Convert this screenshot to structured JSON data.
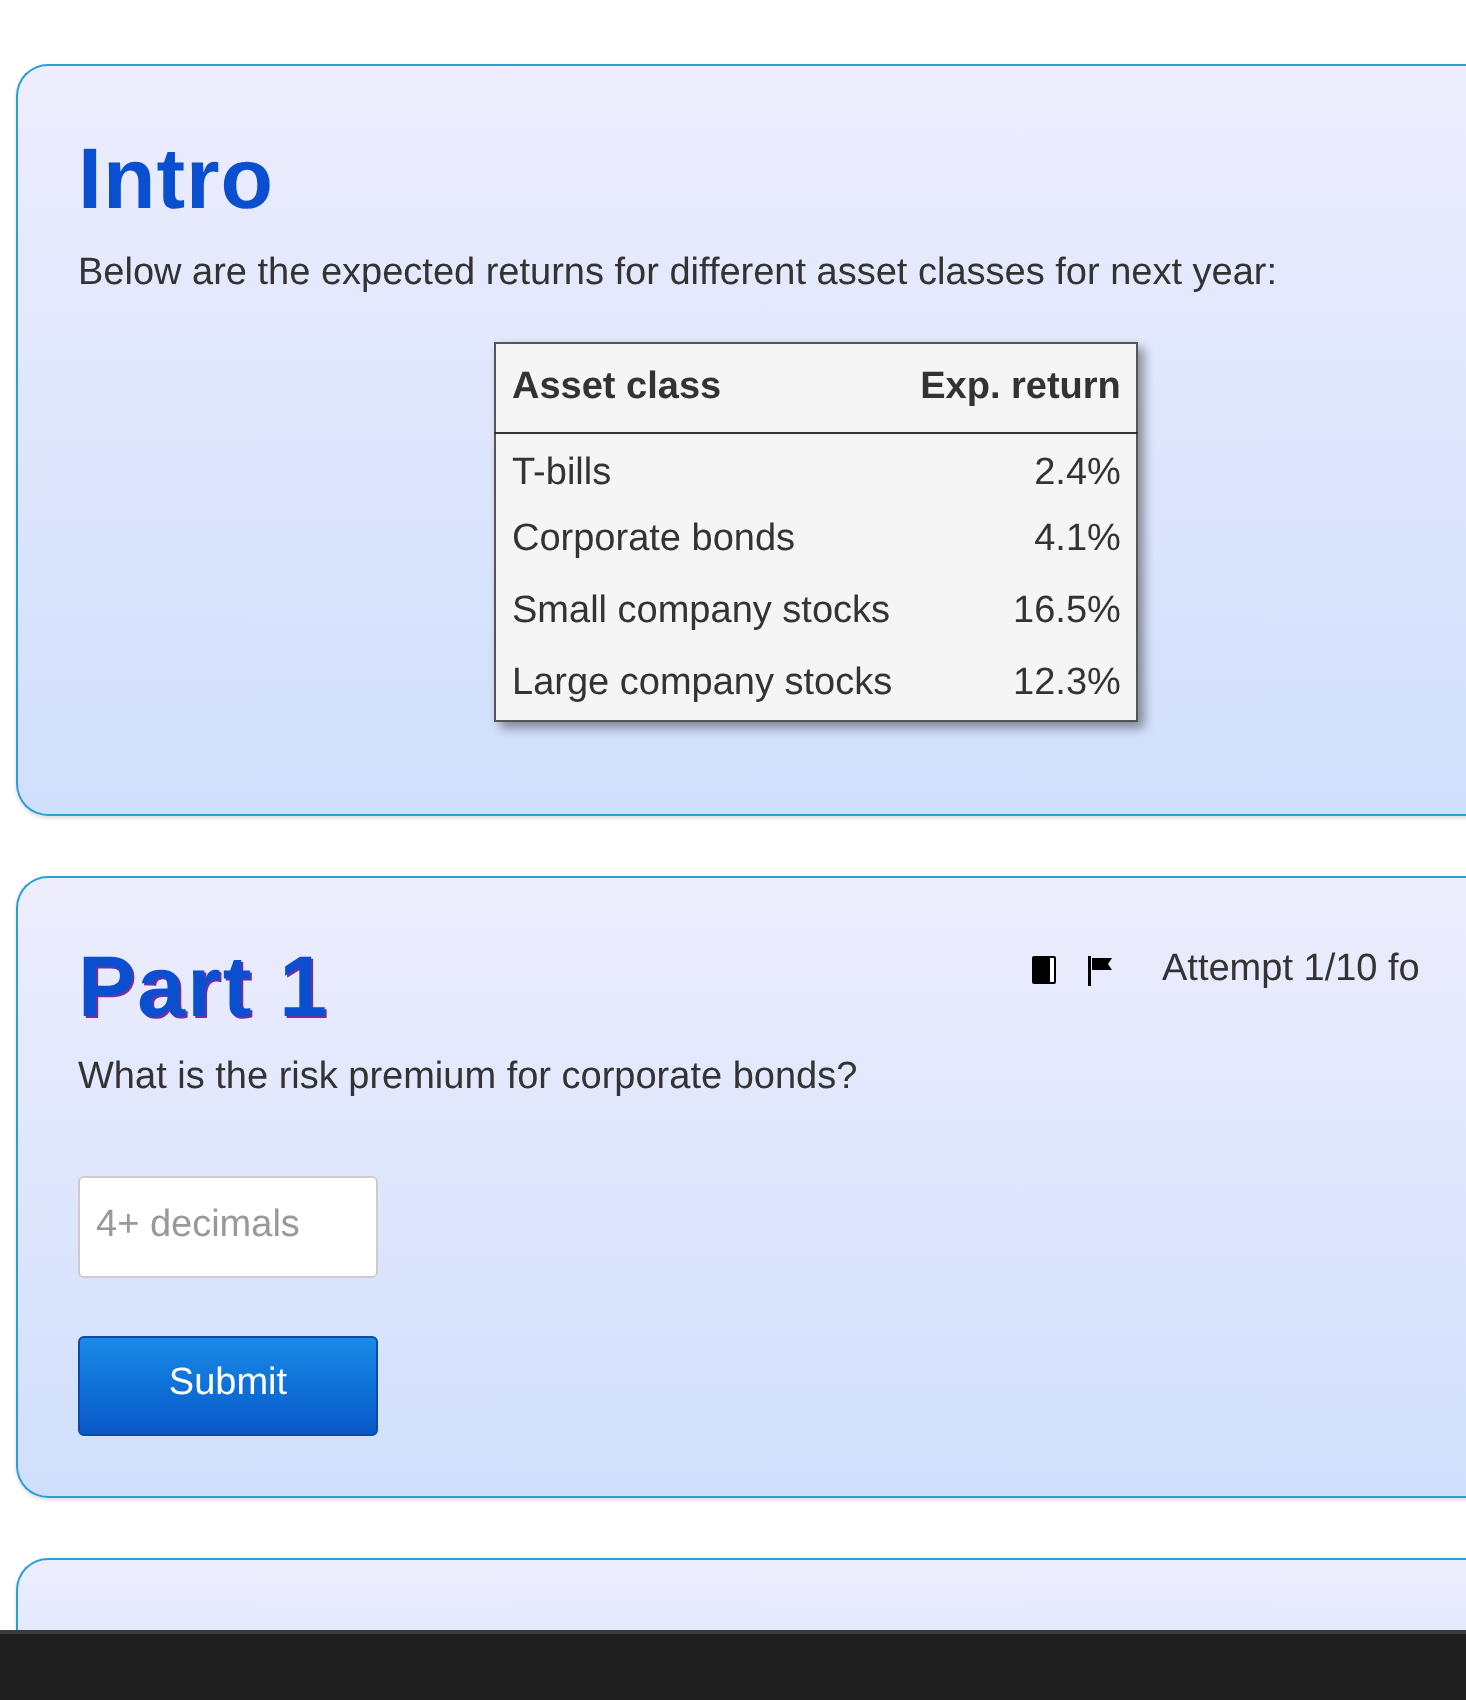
{
  "intro": {
    "title": "Intro",
    "text": "Below are the expected returns for different asset classes for next year:",
    "table": {
      "columns": [
        "Asset class",
        "Exp. return"
      ],
      "rows": [
        [
          "T-bills",
          "2.4%"
        ],
        [
          "Corporate bonds",
          "4.1%"
        ],
        [
          "Small company stocks",
          "16.5%"
        ],
        [
          "Large company stocks",
          "12.3%"
        ]
      ]
    }
  },
  "parts": [
    {
      "title": "Part 1",
      "attempt": "Attempt 1/10 fo",
      "question": "What is the risk premium for corporate bonds?",
      "answer_placeholder": "4+ decimals",
      "button": "Submit"
    }
  ]
}
